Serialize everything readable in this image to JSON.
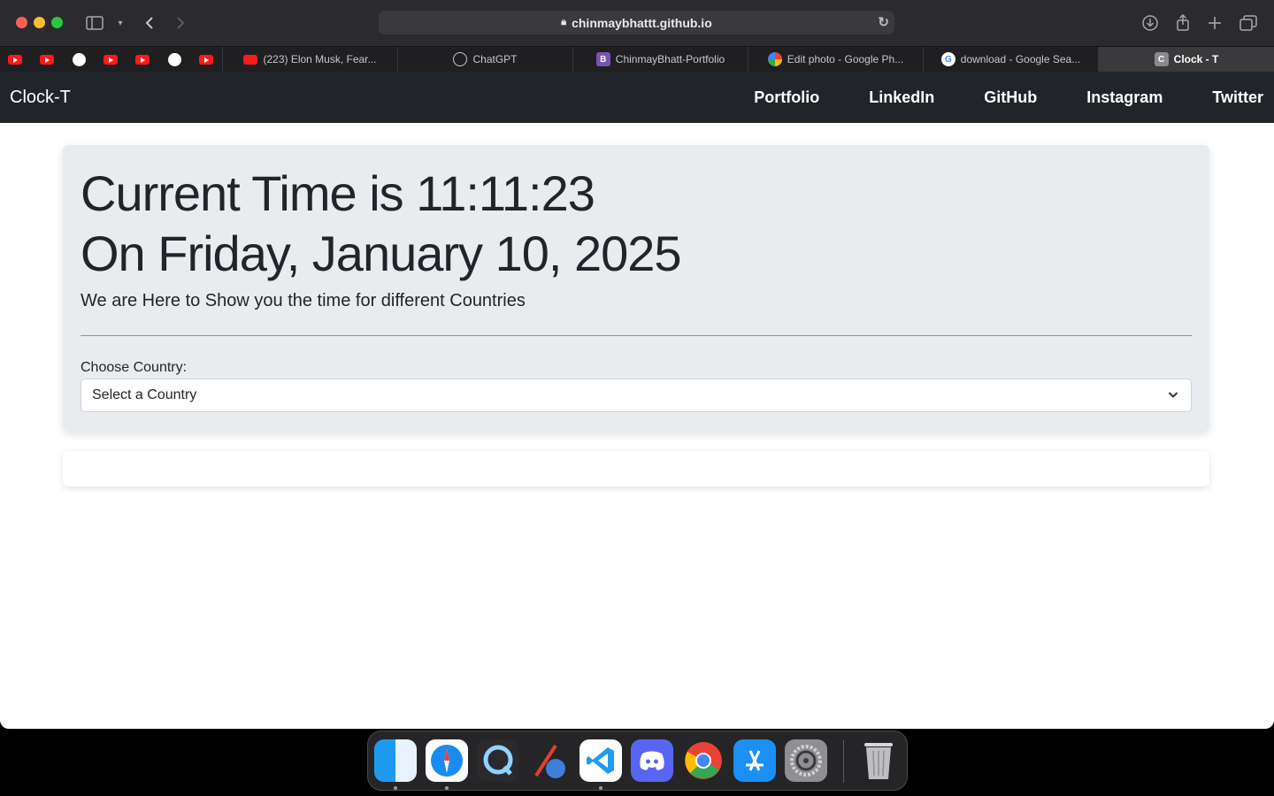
{
  "browser": {
    "url": "chinmaybhattt.github.io",
    "tabs": [
      {
        "label": "(223) Elon Musk, Fear...",
        "favicon": "youtube-icon",
        "active": false
      },
      {
        "label": "ChatGPT",
        "favicon": "chatgpt-icon",
        "active": false
      },
      {
        "label": "ChinmayBhatt-Portfolio",
        "favicon": "bootstrap-icon",
        "active": false
      },
      {
        "label": "Edit photo - Google Ph...",
        "favicon": "google-photos-icon",
        "active": false
      },
      {
        "label": "download - Google Sea...",
        "favicon": "google-icon",
        "active": false
      },
      {
        "label": "Clock - T",
        "favicon": "clock-t-icon",
        "active": true
      }
    ],
    "pinned_tabs": [
      "youtube-icon",
      "youtube-icon",
      "github-icon",
      "youtube-icon",
      "youtube-icon",
      "linkedin-icon",
      "youtube-icon"
    ]
  },
  "navbar": {
    "brand": "Clock-T",
    "links": [
      "Portfolio",
      "LinkedIn",
      "GitHub",
      "Instagram",
      "Twitter"
    ]
  },
  "main": {
    "time_heading": "Current Time is 11:11:23",
    "date_heading": "On Friday, January 10, 2025",
    "lead": "We are Here to Show you the time for different Countries",
    "choose_label": "Choose Country:",
    "select_value": "Select a Country"
  },
  "dock": {
    "apps": [
      "Finder",
      "Safari",
      "QuickTime Player",
      "Xcode Instruments",
      "Visual Studio Code",
      "Discord",
      "Google Chrome",
      "App Store",
      "System Settings",
      "Trash"
    ]
  },
  "colors": {
    "navbar_bg": "#212529",
    "jumbotron_bg": "#e9ecef",
    "titlebar_bg": "#2b2b2d"
  }
}
